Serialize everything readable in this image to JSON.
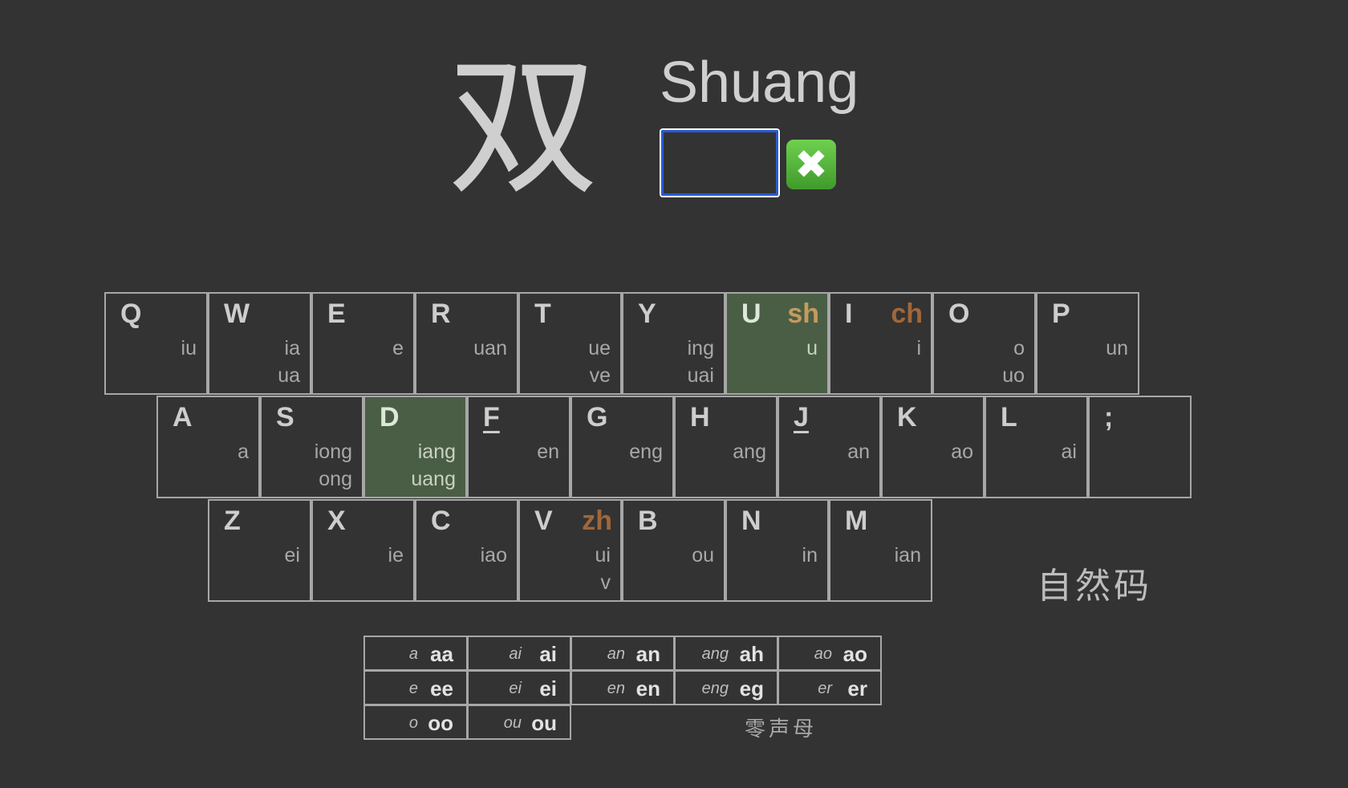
{
  "prompt": {
    "hanzi": "双",
    "pinyin": "Shuang",
    "answer_value": "",
    "wrong_mark": "✖"
  },
  "keyboard": {
    "row1": [
      {
        "letter": "Q",
        "initial": "",
        "finals": [
          "iu"
        ]
      },
      {
        "letter": "W",
        "initial": "",
        "finals": [
          "ia",
          "ua"
        ]
      },
      {
        "letter": "E",
        "initial": "",
        "finals": [
          "e"
        ]
      },
      {
        "letter": "R",
        "initial": "",
        "finals": [
          "uan"
        ]
      },
      {
        "letter": "T",
        "initial": "",
        "finals": [
          "ue",
          "ve"
        ]
      },
      {
        "letter": "Y",
        "initial": "",
        "finals": [
          "ing",
          "uai"
        ]
      },
      {
        "letter": "U",
        "initial": "sh",
        "finals": [
          "u"
        ]
      },
      {
        "letter": "I",
        "initial": "ch",
        "finals": [
          "i"
        ]
      },
      {
        "letter": "O",
        "initial": "",
        "finals": [
          "o",
          "uo"
        ]
      },
      {
        "letter": "P",
        "initial": "",
        "finals": [
          "un"
        ]
      }
    ],
    "row2": [
      {
        "letter": "A",
        "initial": "",
        "finals": [
          "a"
        ]
      },
      {
        "letter": "S",
        "initial": "",
        "finals": [
          "iong",
          "ong"
        ]
      },
      {
        "letter": "D",
        "initial": "",
        "finals": [
          "iang",
          "uang"
        ]
      },
      {
        "letter": "F",
        "initial": "",
        "finals": [
          "en"
        ]
      },
      {
        "letter": "G",
        "initial": "",
        "finals": [
          "eng"
        ]
      },
      {
        "letter": "H",
        "initial": "",
        "finals": [
          "ang"
        ]
      },
      {
        "letter": "J",
        "initial": "",
        "finals": [
          "an"
        ]
      },
      {
        "letter": "K",
        "initial": "",
        "finals": [
          "ao"
        ]
      },
      {
        "letter": "L",
        "initial": "",
        "finals": [
          "ai"
        ]
      },
      {
        "letter": ";",
        "initial": "",
        "finals": []
      }
    ],
    "row3": [
      {
        "letter": "Z",
        "initial": "",
        "finals": [
          "ei"
        ]
      },
      {
        "letter": "X",
        "initial": "",
        "finals": [
          "ie"
        ]
      },
      {
        "letter": "C",
        "initial": "",
        "finals": [
          "iao"
        ]
      },
      {
        "letter": "V",
        "initial": "zh",
        "finals": [
          "ui",
          "v"
        ]
      },
      {
        "letter": "B",
        "initial": "",
        "finals": [
          "ou"
        ]
      },
      {
        "letter": "N",
        "initial": "",
        "finals": [
          "in"
        ]
      },
      {
        "letter": "M",
        "initial": "",
        "finals": [
          "ian"
        ]
      }
    ],
    "highlighted_keys": [
      "U",
      "D"
    ],
    "underlined_keys": [
      "F",
      "J"
    ],
    "colors": {
      "background": "#333333",
      "key_border": "#a7a7a7",
      "highlight": "#4a5e45",
      "initial_sh": "#c49b5e",
      "initial_other": "#a0673a"
    }
  },
  "scheme_name": "自然码",
  "zero_initial": {
    "label": "零声母",
    "rows": [
      [
        {
          "src": "a",
          "code": "aa"
        },
        {
          "src": "ai",
          "code": "ai"
        },
        {
          "src": "an",
          "code": "an"
        },
        {
          "src": "ang",
          "code": "ah"
        },
        {
          "src": "ao",
          "code": "ao"
        }
      ],
      [
        {
          "src": "e",
          "code": "ee"
        },
        {
          "src": "ei",
          "code": "ei"
        },
        {
          "src": "en",
          "code": "en"
        },
        {
          "src": "eng",
          "code": "eg"
        },
        {
          "src": "er",
          "code": "er"
        }
      ],
      [
        {
          "src": "o",
          "code": "oo"
        },
        {
          "src": "ou",
          "code": "ou"
        }
      ]
    ]
  }
}
